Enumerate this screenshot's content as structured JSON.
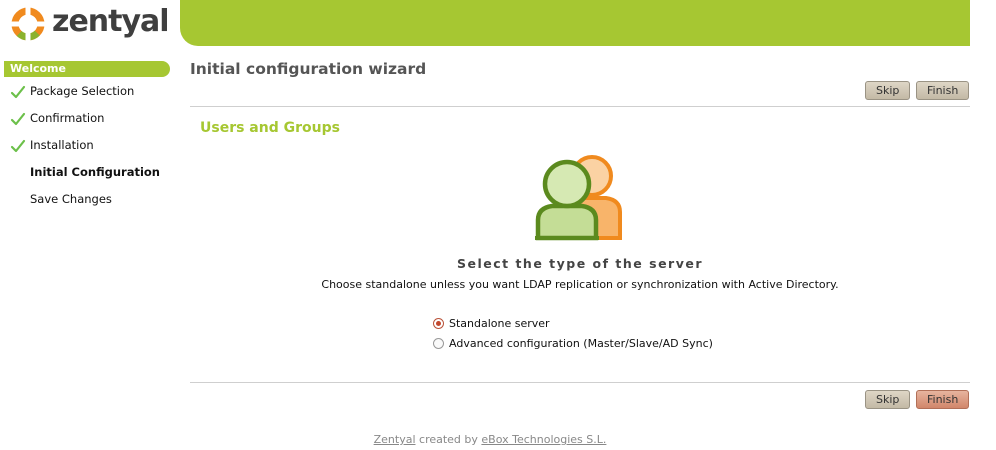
{
  "brand": {
    "name": "zentyal"
  },
  "sidebar": {
    "welcome": "Welcome",
    "steps": [
      {
        "label": "Package Selection",
        "done": true
      },
      {
        "label": "Confirmation",
        "done": true
      },
      {
        "label": "Installation",
        "done": true
      },
      {
        "label": "Initial Configuration",
        "current": true
      },
      {
        "label": "Save Changes"
      }
    ]
  },
  "main": {
    "title": "Initial configuration wizard",
    "top_buttons": {
      "skip": "Skip",
      "finish": "Finish"
    },
    "section_title": "Users and Groups",
    "heading": "Select the type of the server",
    "description": "Choose standalone unless you want LDAP replication or synchronization with Active Directory.",
    "options": [
      {
        "label": "Standalone server",
        "selected": true
      },
      {
        "label": "Advanced configuration (Master/Slave/AD Sync)",
        "selected": false
      }
    ],
    "bottom_buttons": {
      "skip": "Skip",
      "finish": "Finish"
    }
  },
  "footer": {
    "brand_link": "Zentyal",
    "middle": "created by",
    "company_link": "eBox Technologies S.L."
  },
  "colors": {
    "accent_green": "#a6c732",
    "brand_orange": "#f08a1e",
    "selected_radio": "#c2482e"
  },
  "icons": [
    "zentyal-logo-icon",
    "check-icon",
    "users-group-icon"
  ]
}
